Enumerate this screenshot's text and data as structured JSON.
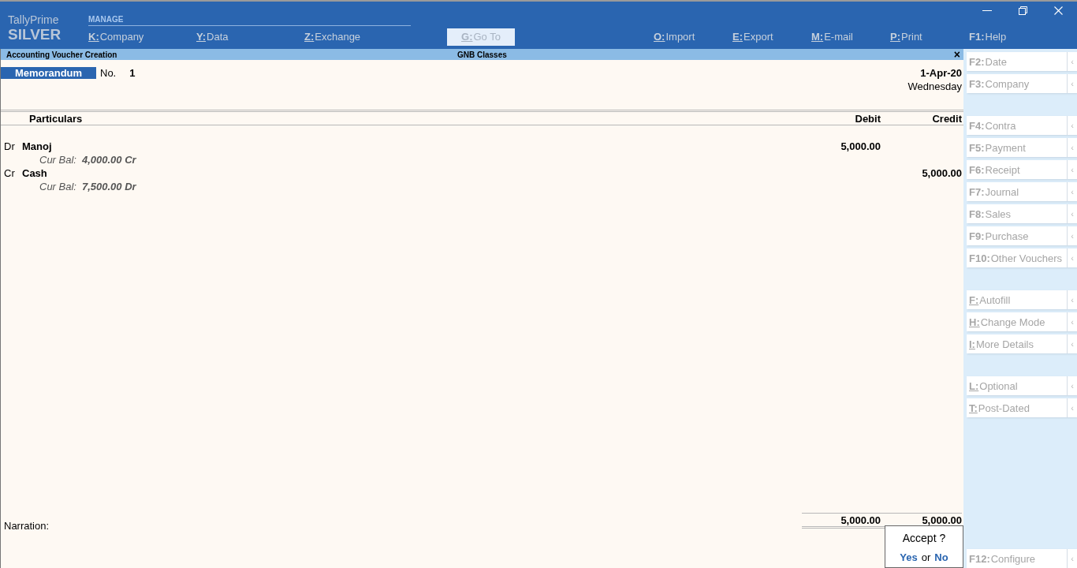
{
  "brand": {
    "product": "TallyPrime",
    "edition": "SILVER"
  },
  "menu": {
    "heading": "MANAGE",
    "left": [
      {
        "key": "K:",
        "label": "Company",
        "underlined": true
      },
      {
        "key": "Y:",
        "label": "Data",
        "underlined": true
      },
      {
        "key": "Z:",
        "label": "Exchange",
        "underlined": true
      }
    ],
    "goto": {
      "key": "G:",
      "label": "Go To",
      "underlined": true,
      "disabled": true
    },
    "right": [
      {
        "key": "O:",
        "label": "Import",
        "underlined": true
      },
      {
        "key": "E:",
        "label": "Export",
        "underlined": true
      },
      {
        "key": "M:",
        "label": "E-mail",
        "underlined": true
      },
      {
        "key": "P:",
        "label": "Print",
        "underlined": true
      },
      {
        "key": "F1:",
        "label": "Help",
        "underlined": false
      }
    ]
  },
  "title_bar": {
    "screen": "Accounting Voucher Creation",
    "company": "GNB Classes",
    "close": "×"
  },
  "voucher": {
    "type": "Memorandum",
    "number_label": "No.",
    "number": "1",
    "date": "1-Apr-20",
    "weekday": "Wednesday"
  },
  "table": {
    "columns": [
      "Particulars",
      "Debit",
      "Credit"
    ],
    "rows": [
      {
        "side": "Dr",
        "ledger": "Manoj",
        "balance_label": "Cur Bal:",
        "balance": "4,000.00 Cr",
        "debit": "5,000.00"
      },
      {
        "side": "Cr",
        "ledger": "Cash",
        "balance_label": "Cur Bal:",
        "balance": "7,500.00 Dr",
        "credit": "5,000.00"
      }
    ],
    "narration_label": "Narration:",
    "total_debit": "5,000.00",
    "total_credit": "5,000.00"
  },
  "dialog": {
    "question": "Accept ?",
    "yes": "Yes",
    "or": "or",
    "no": "No"
  },
  "sidebar": {
    "groups": [
      [
        {
          "key": "F2:",
          "label": "Date",
          "underlined": false
        },
        {
          "key": "F3:",
          "label": "Company",
          "underlined": false
        }
      ],
      [
        {
          "key": "F4:",
          "label": "Contra",
          "underlined": false
        },
        {
          "key": "F5:",
          "label": "Payment",
          "underlined": false
        },
        {
          "key": "F6:",
          "label": "Receipt",
          "underlined": false
        },
        {
          "key": "F7:",
          "label": "Journal",
          "underlined": false
        },
        {
          "key": "F8:",
          "label": "Sales",
          "underlined": false
        },
        {
          "key": "F9:",
          "label": "Purchase",
          "underlined": false
        },
        {
          "key": "F10:",
          "label": "Other Vouchers",
          "underlined": false
        }
      ],
      [
        {
          "key": "F:",
          "label": "Autofill",
          "underlined": true
        },
        {
          "key": "H:",
          "label": "Change Mode",
          "underlined": true
        },
        {
          "key": "I:",
          "label": "More Details",
          "underlined": true
        }
      ],
      [
        {
          "key": "L:",
          "label": "Optional",
          "underlined": true
        },
        {
          "key": "T:",
          "label": "Post-Dated",
          "underlined": true
        }
      ]
    ],
    "bottom": [
      {
        "key": "F12:",
        "label": "Configure",
        "underlined": false
      }
    ],
    "arrow": "‹"
  }
}
